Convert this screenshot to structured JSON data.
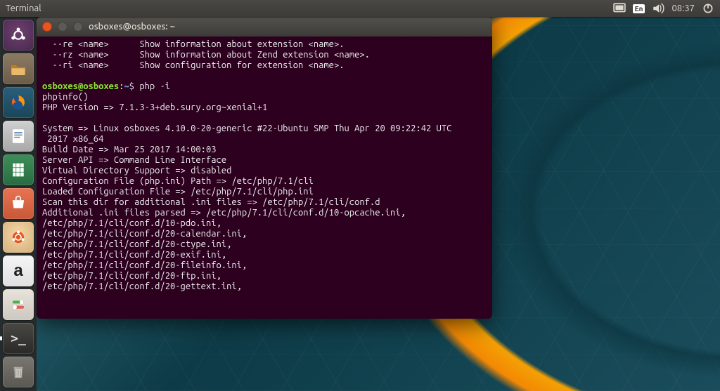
{
  "panel": {
    "app_title": "Terminal",
    "lang": "En",
    "time": "08:37"
  },
  "launcher": {
    "items": [
      {
        "name": "dash",
        "title": "Ubuntu Dash"
      },
      {
        "name": "files",
        "title": "Files"
      },
      {
        "name": "firefox",
        "title": "Firefox"
      },
      {
        "name": "libreoffice-writer",
        "title": "LibreOffice Writer"
      },
      {
        "name": "libreoffice-calc",
        "title": "LibreOffice Calc"
      },
      {
        "name": "software-center",
        "title": "Ubuntu Software"
      },
      {
        "name": "ubuntu-help",
        "title": "Help"
      },
      {
        "name": "amazon",
        "title": "Amazon"
      },
      {
        "name": "system-settings",
        "title": "System Settings"
      },
      {
        "name": "terminal",
        "title": "Terminal"
      },
      {
        "name": "trash",
        "title": "Trash"
      }
    ]
  },
  "terminal": {
    "title": "osboxes@osboxes: ~",
    "prompt_user_host": "osboxes@osboxes",
    "prompt_colon": ":",
    "prompt_path": "~",
    "prompt_dollar": "$ ",
    "command": "php -i",
    "help_lines": [
      "  --re <name>      Show information about extension <name>.",
      "  --rz <name>      Show information about Zend extension <name>.",
      "  --ri <name>      Show configuration for extension <name>."
    ],
    "output_lines": [
      "phpinfo()",
      "PHP Version => 7.1.3-3+deb.sury.org~xenial+1",
      "",
      "System => Linux osboxes 4.10.0-20-generic #22-Ubuntu SMP Thu Apr 20 09:22:42 UTC",
      " 2017 x86_64",
      "Build Date => Mar 25 2017 14:00:03",
      "Server API => Command Line Interface",
      "Virtual Directory Support => disabled",
      "Configuration File (php.ini) Path => /etc/php/7.1/cli",
      "Loaded Configuration File => /etc/php/7.1/cli/php.ini",
      "Scan this dir for additional .ini files => /etc/php/7.1/cli/conf.d",
      "Additional .ini files parsed => /etc/php/7.1/cli/conf.d/10-opcache.ini,",
      "/etc/php/7.1/cli/conf.d/10-pdo.ini,",
      "/etc/php/7.1/cli/conf.d/20-calendar.ini,",
      "/etc/php/7.1/cli/conf.d/20-ctype.ini,",
      "/etc/php/7.1/cli/conf.d/20-exif.ini,",
      "/etc/php/7.1/cli/conf.d/20-fileinfo.ini,",
      "/etc/php/7.1/cli/conf.d/20-ftp.ini,",
      "/etc/php/7.1/cli/conf.d/20-gettext.ini,"
    ]
  }
}
